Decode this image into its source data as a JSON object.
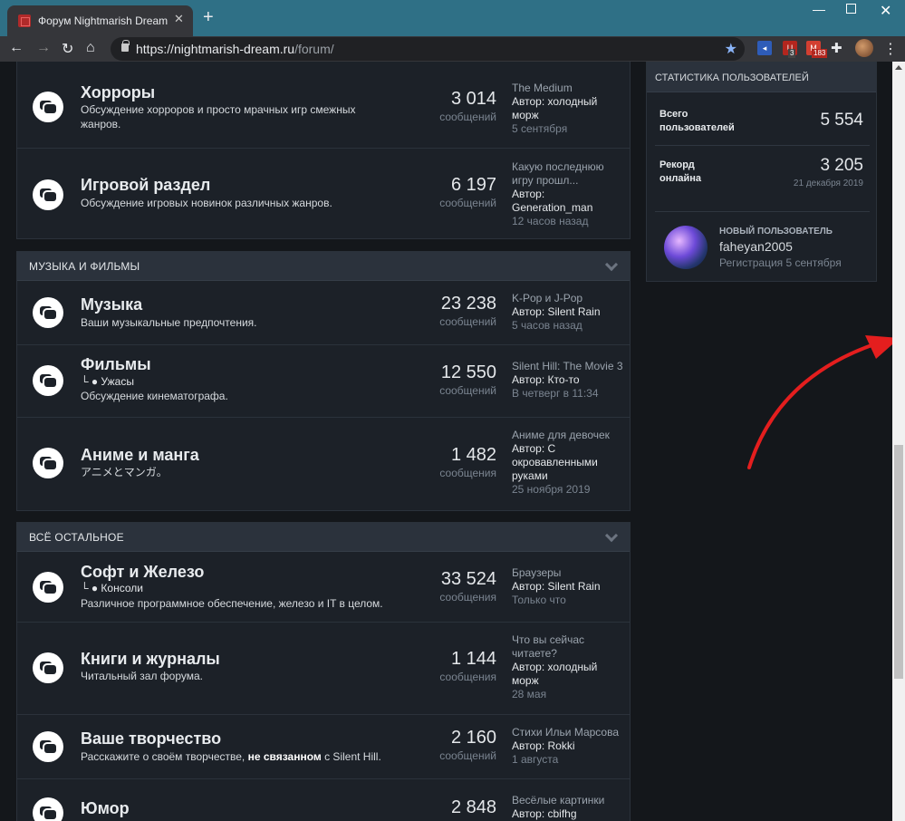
{
  "browser": {
    "tab_title": "Форум Nightmarish Dream",
    "tab_close": "✕",
    "new_tab": "+",
    "url_host": "https://nightmarish-dream.ru",
    "url_path": "/forum/",
    "ext_badges": [
      "3",
      "183"
    ]
  },
  "sections": [
    {
      "title": "",
      "rows": [
        {
          "name": "Хорроры",
          "description": "Обсуждение хорроров и просто мрачных игр смежных жанров.",
          "count": "3 014",
          "count_label": "сообщений",
          "last_title": "The Medium",
          "last_author": "Автор: холодный морж",
          "last_date": "5 сентября"
        },
        {
          "name": "Игровой раздел",
          "description": "Обсуждение игровых новинок различных жанров.",
          "count": "6 197",
          "count_label": "сообщений",
          "last_title": "Какую последнюю игру прошл...",
          "last_author": "Автор: Generation_man",
          "last_date": "12 часов назад"
        }
      ]
    },
    {
      "title": "МУЗЫКА И ФИЛЬМЫ",
      "rows": [
        {
          "name": "Музыка",
          "description": "Ваши музыкальные предпочтения.",
          "count": "23 238",
          "count_label": "сообщений",
          "last_title": "K-Pop и J-Pop",
          "last_author": "Автор: Silent Rain",
          "last_date": "5 часов назад"
        },
        {
          "name": "Фильмы",
          "subforum": "└ ● Ужасы",
          "description": "Обсуждение кинематографа.",
          "count": "12 550",
          "count_label": "сообщений",
          "last_title": "Silent Hill: The Movie 3",
          "last_author": "Автор: Кто-то",
          "last_date": "В четверг в 11:34"
        },
        {
          "name": "Аниме и манга",
          "description": "アニメとマンガ。",
          "count": "1 482",
          "count_label": "сообщения",
          "last_title": "Аниме для девочек",
          "last_author": "Автор: С окровавленными руками",
          "last_date": "25 ноября 2019"
        }
      ]
    },
    {
      "title": "ВСЁ ОСТАЛЬНОЕ",
      "rows": [
        {
          "name": "Софт и Железо",
          "subforum": "└ ● Консоли",
          "description": "Различное программное обеспечение, железо и IT в целом.",
          "count": "33 524",
          "count_label": "сообщения",
          "last_title": "Браузеры",
          "last_author": "Автор: Silent Rain",
          "last_date": "Только что"
        },
        {
          "name": "Книги и журналы",
          "description": "Читальный зал форума.",
          "count": "1 144",
          "count_label": "сообщения",
          "last_title": "Что вы сейчас читаете?",
          "last_author": "Автор: холодный морж",
          "last_date": "28 мая"
        },
        {
          "name": "Ваше творчество",
          "description_pre": "Расскажите о своём творчестве, ",
          "description_bold": "не связанном",
          "description_post": " с Silent Hill.",
          "count": "2 160",
          "count_label": "сообщений",
          "last_title": "Стихи Ильи Марсова",
          "last_author": "Автор: Rokki",
          "last_date": "1 августа"
        },
        {
          "name": "Юмор",
          "count": "2 848",
          "last_title": "Весёлые картинки",
          "last_author": "Автор: cbifhg"
        }
      ]
    }
  ],
  "stats": {
    "title": "СТАТИСТИКА ПОЛЬЗОВАТЕЛЕЙ",
    "total_users_label_1": "Всего",
    "total_users_label_2": "пользователей",
    "total_users_value": "5 554",
    "record_label_1": "Рекорд",
    "record_label_2": "онлайна",
    "record_value": "3 205",
    "record_date": "21 декабря 2019",
    "new_user_label": "НОВЫЙ ПОЛЬЗОВАТЕЛЬ",
    "new_user_name": "faheyan2005",
    "new_user_reg": "Регистрация 5 сентября"
  },
  "colors": {
    "accent_arrow": "#e41e1e",
    "tab_strip": "#2f7086",
    "page_bg": "#14171b"
  }
}
